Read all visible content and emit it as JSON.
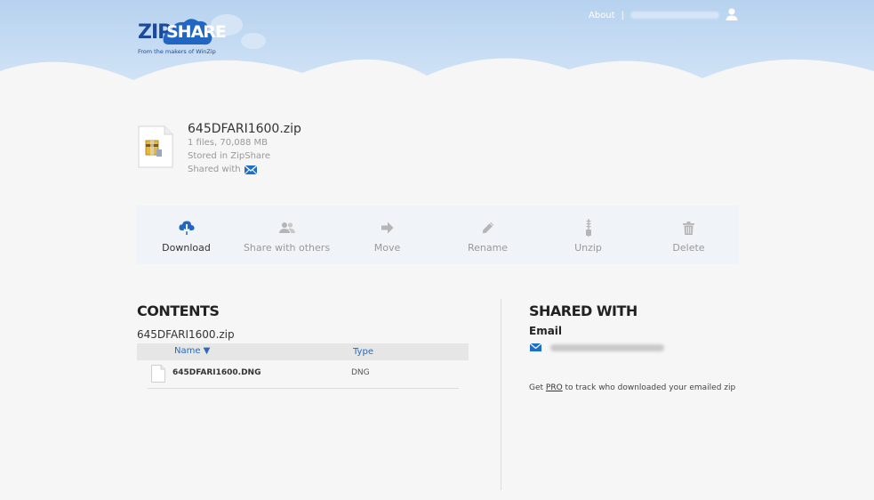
{
  "header": {
    "logo_zip": "ZIP",
    "logo_share": "SHARE",
    "logo_tagline": "From the makers of WinZip",
    "nav_about": "About",
    "nav_separator": "|"
  },
  "file": {
    "name": "645DFARI1600.zip",
    "count_size": "1 files, 70,088 MB",
    "stored": "Stored in ZipShare",
    "shared_with": "Shared with"
  },
  "toolbar": [
    {
      "label": "Download",
      "icon": "cloud-download-icon",
      "active": true
    },
    {
      "label": "Share with others",
      "icon": "users-icon",
      "active": false
    },
    {
      "label": "Move",
      "icon": "arrow-right-icon",
      "active": false
    },
    {
      "label": "Rename",
      "icon": "pencil-icon",
      "active": false
    },
    {
      "label": "Unzip",
      "icon": "zipper-icon",
      "active": false
    },
    {
      "label": "Delete",
      "icon": "trash-icon",
      "active": false
    }
  ],
  "contents": {
    "title": "CONTENTS",
    "zip_name": "645DFARI1600.zip",
    "col_name": "Name ▼",
    "col_type": "Type",
    "rows": [
      {
        "name": "645DFARI1600.DNG",
        "type": "DNG"
      }
    ]
  },
  "shared": {
    "title": "SHARED WITH",
    "email_label": "Email",
    "pro_prefix": "Get ",
    "pro_link": "PRO",
    "pro_suffix": " to track who downloaded your emailed zip"
  },
  "colors": {
    "accent": "#2a6bb5",
    "sky": "#c5dcf3",
    "logo_blue": "#1b4a9c"
  }
}
